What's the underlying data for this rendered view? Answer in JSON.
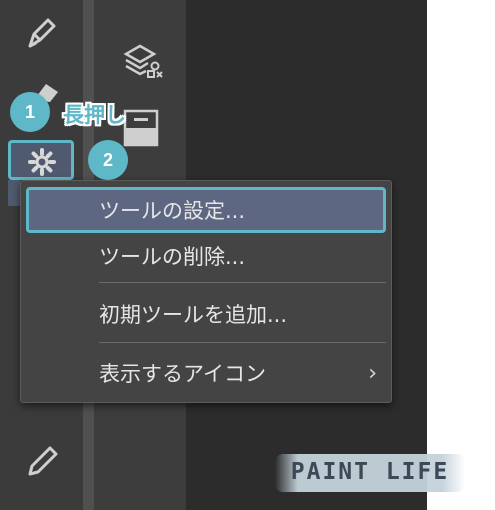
{
  "annotations": {
    "step1_number": "1",
    "step1_text": "長押し",
    "step2_number": "2"
  },
  "context_menu": {
    "items": [
      {
        "label": "ツールの設定...",
        "highlighted": true
      },
      {
        "label": "ツールの削除..."
      },
      {
        "label": "初期ツールを追加..."
      },
      {
        "label": "表示するアイコン",
        "has_submenu": true
      }
    ],
    "submenu_glyph": "›"
  },
  "watermark": "PAINT LIFE",
  "colors": {
    "accent": "#5eb8c8",
    "menu_bg": "#444444",
    "menu_highlight": "#5d6782",
    "panel_dark": "#3b3b3b"
  },
  "icons": [
    "pen-icon",
    "eraser-icon",
    "gear-icon",
    "brush-icon",
    "layer-stack-icon",
    "layer-property-icon"
  ]
}
